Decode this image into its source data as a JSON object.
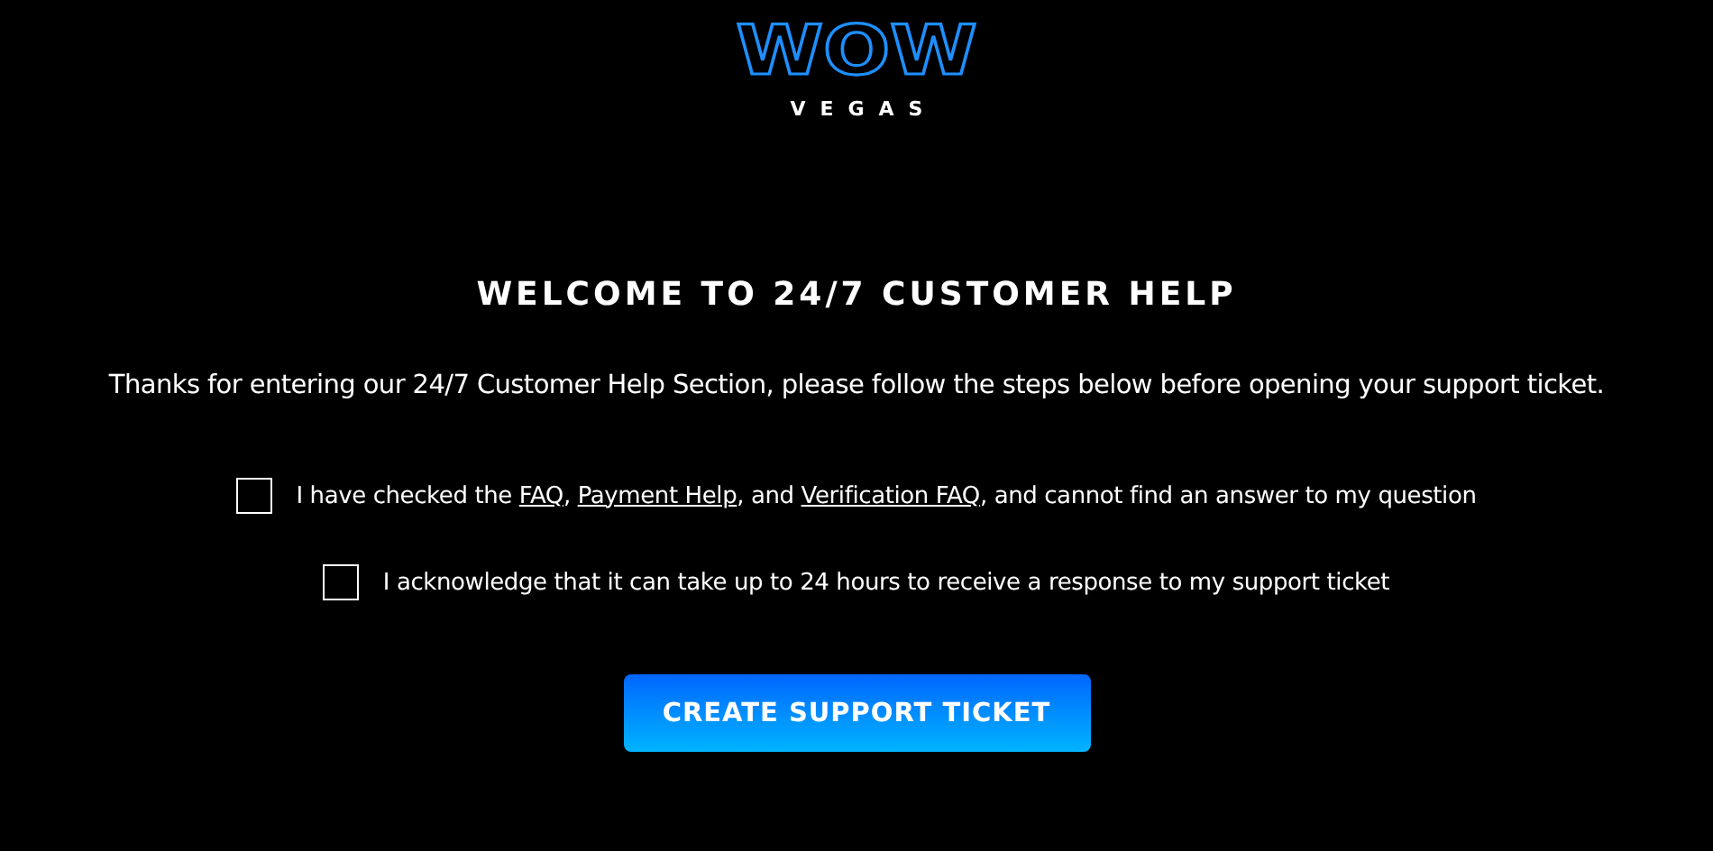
{
  "logo": {
    "mark": "WOW",
    "word": "VEGAS"
  },
  "heading": "WELCOME TO 24/7 CUSTOMER HELP",
  "intro": "Thanks for entering our 24/7 Customer Help Section, please follow the steps below before opening your support ticket.",
  "checks": [
    {
      "checked": false,
      "parts": [
        {
          "kind": "text",
          "text": "I have checked the "
        },
        {
          "kind": "link",
          "text": "FAQ"
        },
        {
          "kind": "text",
          "text": ", "
        },
        {
          "kind": "link",
          "text": "Payment Help"
        },
        {
          "kind": "text",
          "text": ", and "
        },
        {
          "kind": "link",
          "text": "Verification FAQ"
        },
        {
          "kind": "text",
          "text": ", and cannot find an answer to my question"
        }
      ]
    },
    {
      "checked": false,
      "parts": [
        {
          "kind": "text",
          "text": "I acknowledge that it can take up to 24 hours to receive a response to my support ticket"
        }
      ]
    }
  ],
  "button": "CREATE SUPPORT TICKET"
}
